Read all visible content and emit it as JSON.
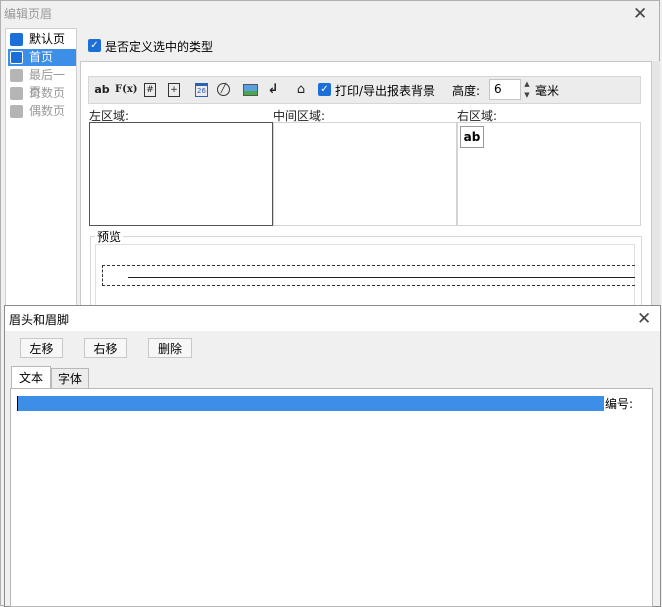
{
  "outer_dialog": {
    "title": "编辑页眉",
    "sidebar": {
      "items": [
        {
          "label": "默认页",
          "icon": "header-page-icon",
          "selected": false,
          "enabled": true
        },
        {
          "label": "首页",
          "icon": "header-page-icon",
          "selected": true,
          "enabled": true
        },
        {
          "label": "最后一页",
          "icon": "header-page-icon",
          "selected": false,
          "enabled": false
        },
        {
          "label": "奇数页",
          "icon": "header-page-icon",
          "selected": false,
          "enabled": false
        },
        {
          "label": "偶数页",
          "icon": "header-page-icon",
          "selected": false,
          "enabled": false
        }
      ]
    },
    "customize_checkbox": {
      "label": "是否定义选中的类型",
      "checked": true
    },
    "toolbar": {
      "text_btn": "ab",
      "formula_btn": "F(x)",
      "page_number_icon": "#",
      "calendar_number": "26",
      "print_checkbox_label": "打印/导出报表背景",
      "print_checked": true,
      "height_label": "高度:",
      "height_value": "6",
      "height_unit": "毫米"
    },
    "areas": {
      "left_label": "左区域:",
      "middle_label": "中间区域:",
      "right_label": "右区域:",
      "right_item": "ab"
    },
    "preview_label": "预览"
  },
  "inner_dialog": {
    "title": "眉头和眉脚",
    "buttons": {
      "move_left": "左移",
      "move_right": "右移",
      "delete": "删除"
    },
    "tabs": [
      {
        "label": "文本",
        "active": true
      },
      {
        "label": "字体",
        "active": false
      }
    ],
    "text_value": "编号:",
    "colors": {
      "selection": "#3d8ee6",
      "accent": "#1b6fd9"
    }
  }
}
